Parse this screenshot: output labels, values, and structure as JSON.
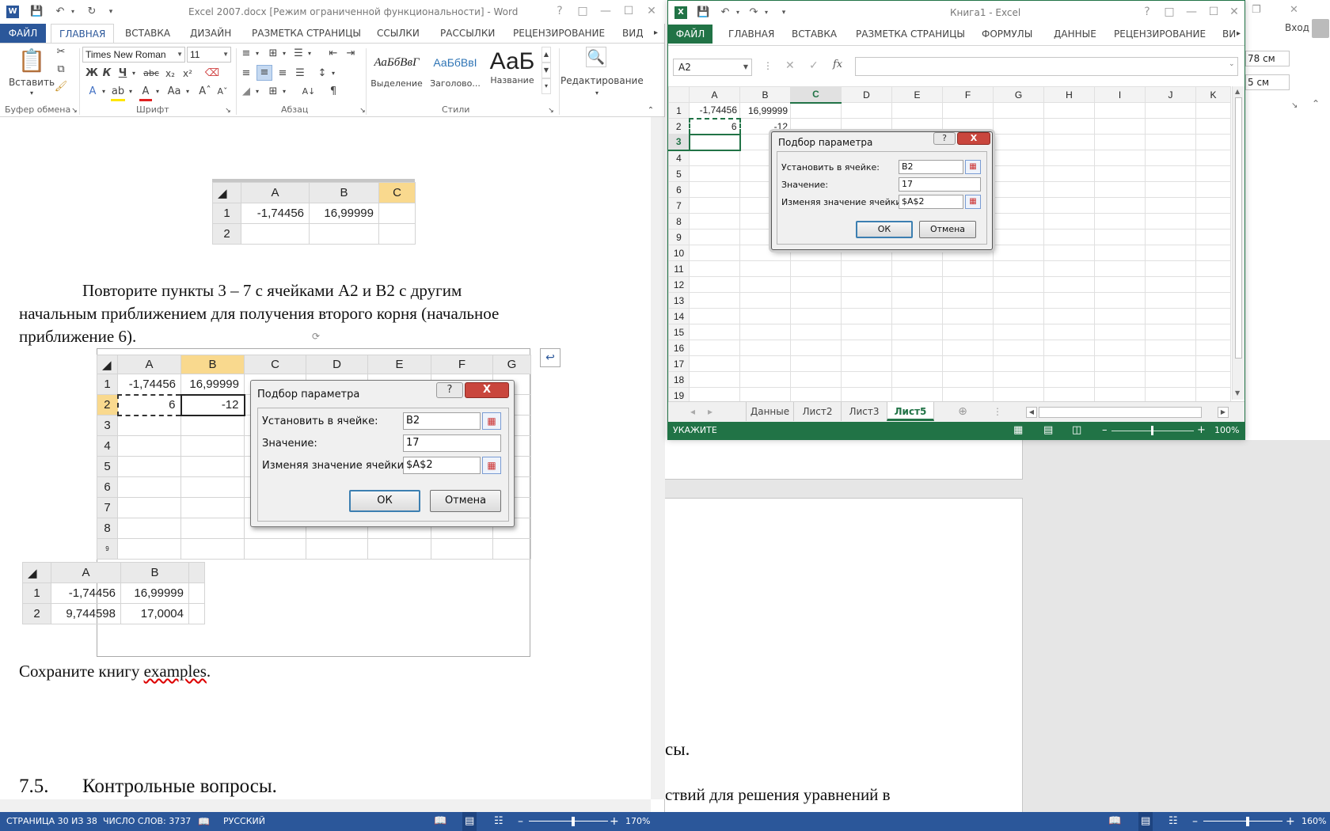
{
  "word": {
    "title": "Excel 2007.docx [Режим ограниченной функциональности] - Word",
    "file_tab": "ФАЙЛ",
    "tabs": [
      "ГЛАВНАЯ",
      "ВСТАВКА",
      "ДИЗАЙН",
      "РАЗМЕТКА СТРАНИЦЫ",
      "ССЫЛКИ",
      "РАССЫЛКИ",
      "РЕЦЕНЗИРОВАНИЕ",
      "ВИД"
    ],
    "paste_label": "Вставить",
    "font_name": "Times New Roman",
    "font_size": "11",
    "groups": {
      "clipboard": "Буфер обмена",
      "font": "Шрифт",
      "paragraph": "Абзац",
      "styles": "Стили"
    },
    "styles": [
      {
        "sample": "АаБбВвГ",
        "name": "Выделение"
      },
      {
        "sample": "АаБбВвІ",
        "name": "Заголово..."
      },
      {
        "sample": "АаБ",
        "name": "Название"
      }
    ],
    "editing_label": "Редактирование",
    "doc": {
      "table1": {
        "cols": [
          "A",
          "B",
          "C"
        ],
        "rows": [
          [
            "1",
            "-1,74456",
            "16,99999"
          ],
          [
            "2",
            "",
            ""
          ]
        ]
      },
      "para1_line1": "Повторите пункты 3 – 7 с ячейками A2 и B2 с другим",
      "para1_line2": "начальным приближением для получения второго корня (начальное",
      "para1_line3": "приближение 6).",
      "table2": {
        "cols": [
          "A",
          "B",
          "C",
          "D",
          "E",
          "F",
          "G"
        ],
        "row1": [
          "1",
          "-1,74456",
          "16,99999"
        ],
        "row2": [
          "2",
          "6",
          "-12"
        ],
        "rows_more": [
          "3",
          "4",
          "5",
          "6",
          "7",
          "8",
          "9"
        ]
      },
      "dialog": {
        "title": "Подбор параметра",
        "help": "?",
        "close": "X",
        "set_cell_label": "Установить в ячейке:",
        "set_cell_value": "B2",
        "value_label": "Значение:",
        "value_value": "17",
        "changing_label": "Изменяя значение ячейки:",
        "changing_value": "$A$2",
        "ok": "ОК",
        "cancel": "Отмена"
      },
      "table3": {
        "cols": [
          "A",
          "B"
        ],
        "rows": [
          [
            "1",
            "-1,74456",
            "16,99999"
          ],
          [
            "2",
            "9,744598",
            "17,0004"
          ]
        ]
      },
      "save_line_prefix": "Сохраните книгу ",
      "save_line_word": "examples",
      "save_line_suffix": ".",
      "heading_num": "7.5.",
      "heading_text": "Контрольные вопросы.",
      "behind_text1": "сы.",
      "behind_text2": "ствий для решения уравнений в"
    },
    "status": {
      "page": "СТРАНИЦА 30 ИЗ 38",
      "words": "ЧИСЛО СЛОВ: 3737",
      "lang": "РУССКИЙ",
      "zoom": "170%"
    },
    "right_status_zoom": "160%"
  },
  "excel": {
    "title": "Книга1 - Excel",
    "file_tab": "ФАЙЛ",
    "tabs": [
      "ГЛАВНАЯ",
      "ВСТАВКА",
      "РАЗМЕТКА СТРАНИЦЫ",
      "ФОРМУЛЫ",
      "ДАННЫЕ",
      "РЕЦЕНЗИРОВАНИЕ",
      "ВИ"
    ],
    "signin": "Вход",
    "name_box": "A2",
    "fx": "fx",
    "columns": [
      "A",
      "B",
      "C",
      "D",
      "E",
      "F",
      "G",
      "H",
      "I",
      "J",
      "K"
    ],
    "rows": [
      "1",
      "2",
      "3",
      "4",
      "5",
      "6",
      "7",
      "8",
      "9",
      "10",
      "11",
      "12",
      "13",
      "14",
      "15",
      "16",
      "17",
      "18",
      "19"
    ],
    "cells": {
      "A1": "-1,74456",
      "B1": "16,99999",
      "A2": "6",
      "B2": "-12"
    },
    "dialog": {
      "title": "Подбор параметра",
      "help": "?",
      "close": "X",
      "set_cell_label": "Установить в ячейке:",
      "set_cell_value": "B2",
      "value_label": "Значение:",
      "value_value": "17",
      "changing_label": "Изменяя значение ячейки:",
      "changing_value": "$A$2",
      "ok": "ОК",
      "cancel": "Отмена"
    },
    "sheets": [
      "Данные",
      "Лист2",
      "Лист3",
      "Лист5"
    ],
    "active_sheet": "Лист5",
    "status_mode": "УКАЖИТЕ",
    "zoom": "100%",
    "behind_ribbon_1": "78 см",
    "behind_ribbon_2": "5 см"
  },
  "colors": {
    "word_blue": "#2b579a",
    "excel_green": "#217346",
    "close_red": "#c9463d",
    "header_selected": "#f9d98e"
  }
}
